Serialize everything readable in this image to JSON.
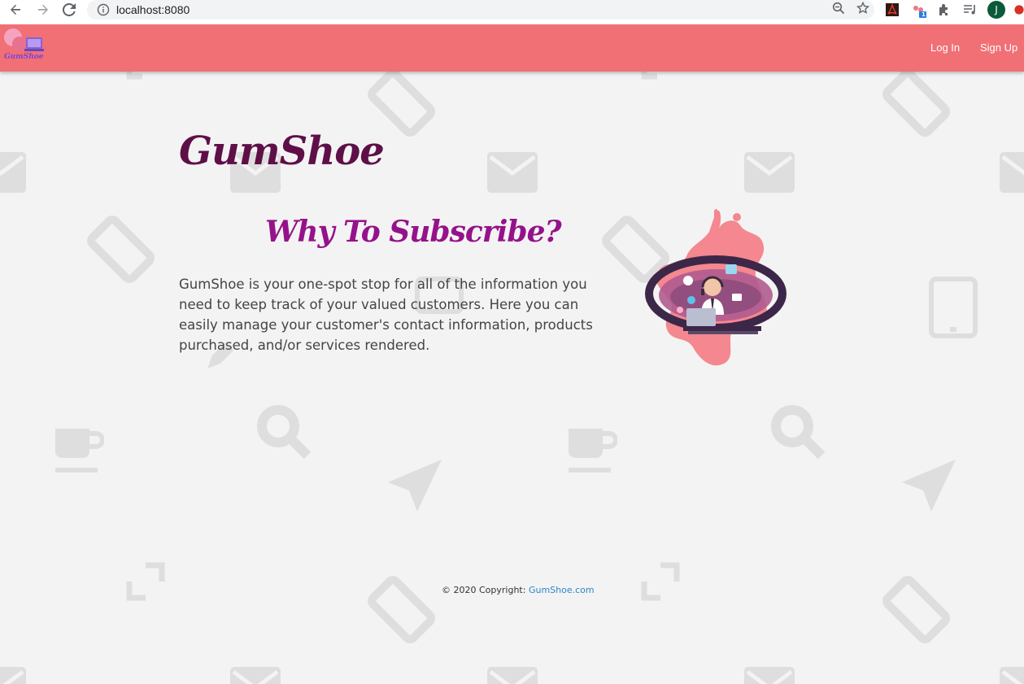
{
  "browser": {
    "url": "localhost:8080",
    "profile_initial": "J",
    "extension_badge": "1"
  },
  "navbar": {
    "logo_text": "GumShoe",
    "login_label": "Log In",
    "signup_label": "Sign Up"
  },
  "hero": {
    "brand_title": "GumShoe",
    "subtitle": "Why To Subscribe?",
    "description": "GumShoe is your one-spot stop for all of the information you need to keep track of your valued customers. Here you can easily manage your customer's contact information, products purchased, and/or services rendered."
  },
  "footer": {
    "copyright": "© 2020 Copyright: ",
    "link_text": "GumShoe.com"
  },
  "colors": {
    "navbar_bg": "#f07075",
    "brand": "#5e0f48",
    "subtitle": "#95128a",
    "link": "#2a87c9",
    "page_bg": "#f3f3f3"
  }
}
